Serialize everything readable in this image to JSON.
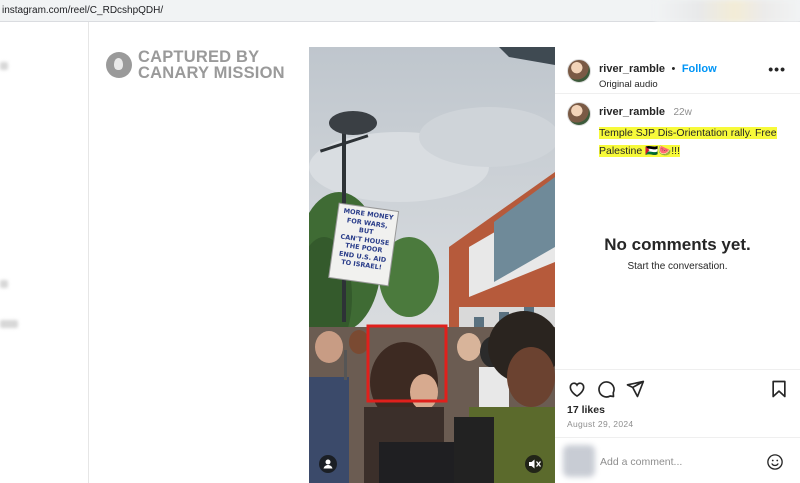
{
  "browser": {
    "url": "instagram.com/reel/C_RDcshpQDH/"
  },
  "watermark": {
    "line1": "CAPTURED BY",
    "line2": "CANARY MISSION"
  },
  "video": {
    "sign_lines": [
      "MORE MONEY",
      "FOR WARS, BUT",
      "CAN'T HOUSE",
      "THE POOR",
      "END U.S. AID",
      "TO ISRAEL!"
    ],
    "highlight_color": "#e0201c"
  },
  "post": {
    "username": "river_ramble",
    "dot": "•",
    "follow_label": "Follow",
    "audio": "Original audio",
    "more_icon": "•••",
    "caption_user": "river_ramble",
    "caption_time": "22w",
    "caption_line1": "Temple SJP Dis-Orientation rally. Free",
    "caption_line2": "Palestine 🇵🇸🍉!!!",
    "no_comments_title": "No comments yet.",
    "no_comments_sub": "Start the conversation.",
    "likes": "17 likes",
    "date": "August 29, 2024",
    "comment_placeholder": "Add a comment..."
  },
  "colors": {
    "follow": "#0095f6",
    "highlight": "#f7fa3a",
    "text": "#262626",
    "muted": "#8e8e8e"
  },
  "icons": [
    "heart-icon",
    "comment-icon",
    "share-icon",
    "bookmark-icon",
    "emoji-icon",
    "user-tag-icon",
    "mute-icon",
    "more-icon"
  ]
}
